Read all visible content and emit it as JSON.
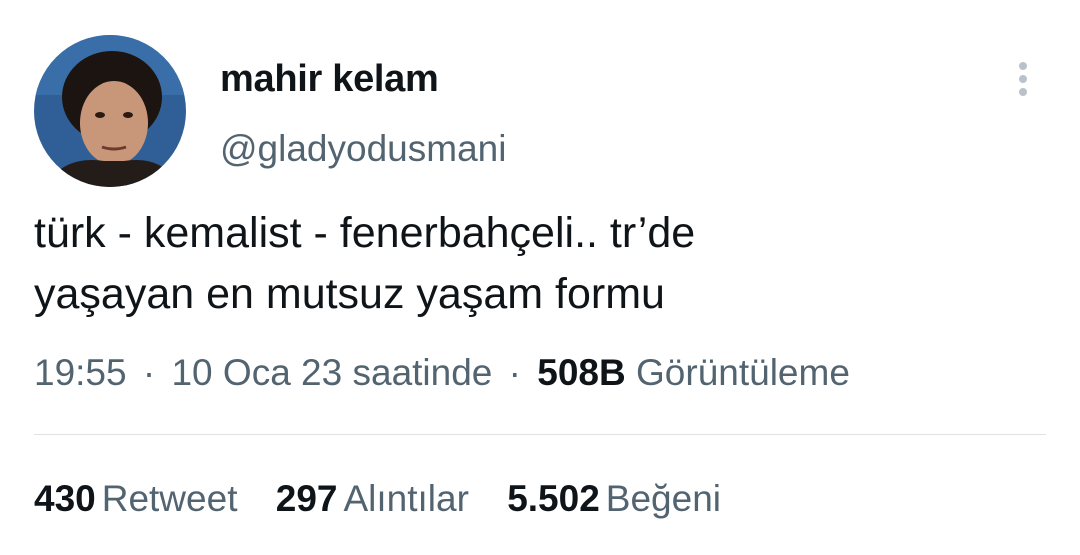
{
  "user": {
    "display_name": "mahir kelam",
    "handle": "@gladyodusmani",
    "avatar_icon": "profile-photo"
  },
  "tweet": {
    "text_line1": "türk - kemalist - fenerbahçeli.. tr’de",
    "text_line2": "yaşayan en mutsuz yaşam formu"
  },
  "meta": {
    "time": "19:55",
    "separator": "·",
    "date": "10 Oca 23 saatinde",
    "views_count": "508B",
    "views_label": "Görüntüleme"
  },
  "stats": {
    "retweets_count": "430",
    "retweets_label": "Retweet",
    "quotes_count": "297",
    "quotes_label": "Alıntılar",
    "likes_count": "5.502",
    "likes_label": "Beğeni"
  },
  "colors": {
    "primary_text": "#0f1419",
    "secondary_text": "#536471",
    "divider": "#dfe3e6",
    "avatar_bg": "#2f5f96"
  },
  "icons": {
    "more": "more-vertical-icon"
  }
}
